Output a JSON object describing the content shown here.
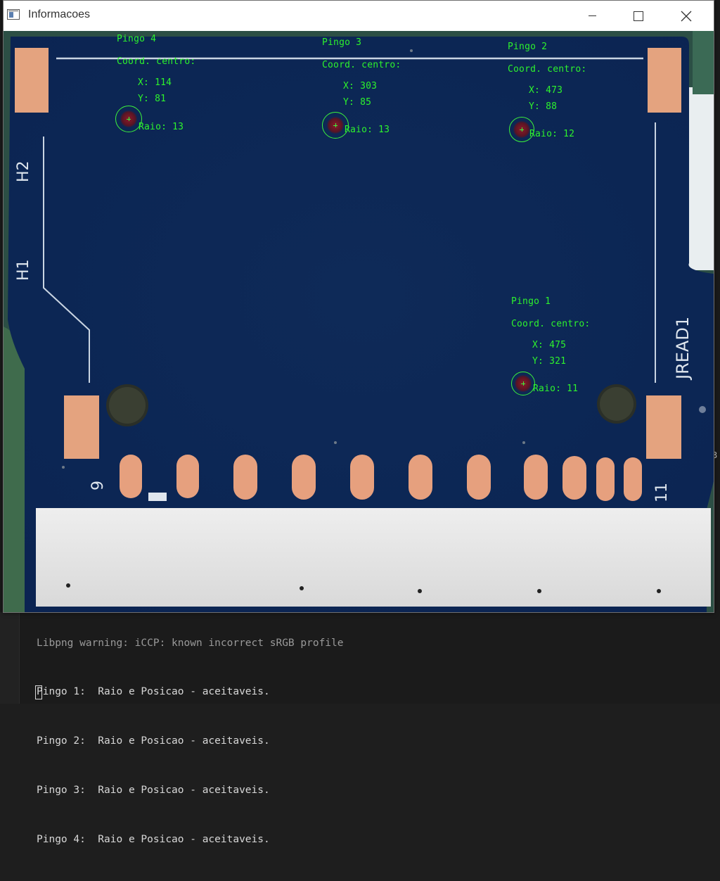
{
  "window": {
    "title": "Informacoes",
    "icon": "app-window-icon",
    "controls": [
      "minimize-icon",
      "maximize-icon",
      "close-icon"
    ]
  },
  "board": {
    "silkscreen": [
      "H2",
      "H1",
      "JREAD1",
      "9",
      "11"
    ],
    "colors": {
      "pcb": "#0f2d5c",
      "pad": "#e7a07c",
      "overlay": "#2df22d"
    }
  },
  "drops": [
    {
      "heading": "Pingo 4",
      "coord_label": "Coord. centro:",
      "x_text": "X: 114",
      "y_text": "Y: 81",
      "radius_text": "Raio: 13"
    },
    {
      "heading": "Pingo 3",
      "coord_label": "Coord. centro:",
      "x_text": "X: 303",
      "y_text": "Y: 85",
      "radius_text": "Raio: 13"
    },
    {
      "heading": "Pingo 2",
      "coord_label": "Coord. centro:",
      "x_text": "X: 473",
      "y_text": "Y: 88",
      "radius_text": "Raio: 12"
    },
    {
      "heading": "Pingo 1",
      "coord_label": "Coord. centro:",
      "x_text": "X: 475",
      "y_text": "Y: 321",
      "radius_text": "Raio: 11"
    }
  ],
  "console": {
    "ghost_line": "Libpng warning: iCCP: known incorrect sRGB profile",
    "lines": [
      "Pingo 1:  Raio e Posicao - aceitaveis.",
      "Pingo 2:  Raio e Posicao - aceitaveis.",
      "Pingo 3:  Raio e Posicao - aceitaveis.",
      "Pingo 4:  Raio e Posicao - aceitaveis."
    ],
    "edge_text": "3"
  }
}
